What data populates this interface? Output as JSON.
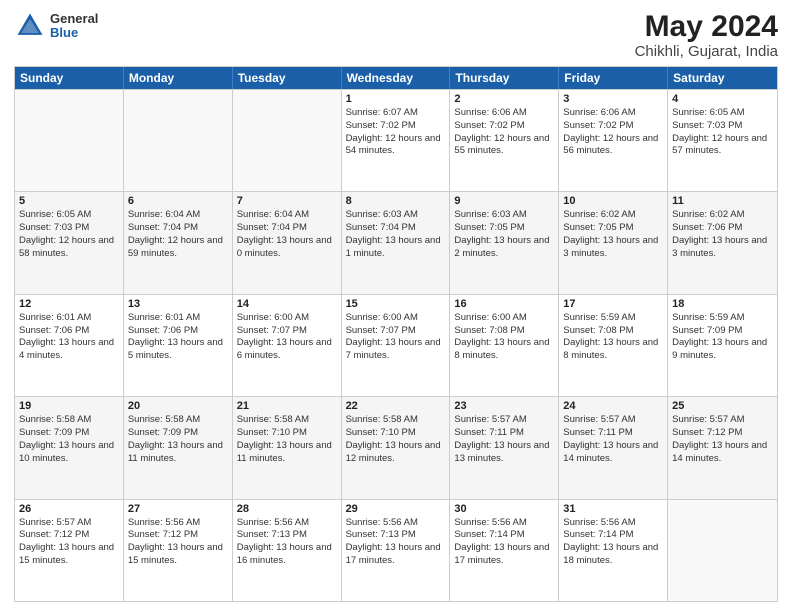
{
  "header": {
    "logo": {
      "general": "General",
      "blue": "Blue"
    },
    "title": "May 2024",
    "location": "Chikhli, Gujarat, India"
  },
  "calendar": {
    "days_of_week": [
      "Sunday",
      "Monday",
      "Tuesday",
      "Wednesday",
      "Thursday",
      "Friday",
      "Saturday"
    ],
    "weeks": [
      [
        {
          "day": "",
          "empty": true
        },
        {
          "day": "",
          "empty": true
        },
        {
          "day": "",
          "empty": true
        },
        {
          "day": "1",
          "sunrise": "6:07 AM",
          "sunset": "7:02 PM",
          "daylight": "12 hours and 54 minutes."
        },
        {
          "day": "2",
          "sunrise": "6:06 AM",
          "sunset": "7:02 PM",
          "daylight": "12 hours and 55 minutes."
        },
        {
          "day": "3",
          "sunrise": "6:06 AM",
          "sunset": "7:02 PM",
          "daylight": "12 hours and 56 minutes."
        },
        {
          "day": "4",
          "sunrise": "6:05 AM",
          "sunset": "7:03 PM",
          "daylight": "12 hours and 57 minutes."
        }
      ],
      [
        {
          "day": "5",
          "sunrise": "6:05 AM",
          "sunset": "7:03 PM",
          "daylight": "12 hours and 58 minutes."
        },
        {
          "day": "6",
          "sunrise": "6:04 AM",
          "sunset": "7:04 PM",
          "daylight": "12 hours and 59 minutes."
        },
        {
          "day": "7",
          "sunrise": "6:04 AM",
          "sunset": "7:04 PM",
          "daylight": "13 hours and 0 minutes."
        },
        {
          "day": "8",
          "sunrise": "6:03 AM",
          "sunset": "7:04 PM",
          "daylight": "13 hours and 1 minute."
        },
        {
          "day": "9",
          "sunrise": "6:03 AM",
          "sunset": "7:05 PM",
          "daylight": "13 hours and 2 minutes."
        },
        {
          "day": "10",
          "sunrise": "6:02 AM",
          "sunset": "7:05 PM",
          "daylight": "13 hours and 3 minutes."
        },
        {
          "day": "11",
          "sunrise": "6:02 AM",
          "sunset": "7:06 PM",
          "daylight": "13 hours and 3 minutes."
        }
      ],
      [
        {
          "day": "12",
          "sunrise": "6:01 AM",
          "sunset": "7:06 PM",
          "daylight": "13 hours and 4 minutes."
        },
        {
          "day": "13",
          "sunrise": "6:01 AM",
          "sunset": "7:06 PM",
          "daylight": "13 hours and 5 minutes."
        },
        {
          "day": "14",
          "sunrise": "6:00 AM",
          "sunset": "7:07 PM",
          "daylight": "13 hours and 6 minutes."
        },
        {
          "day": "15",
          "sunrise": "6:00 AM",
          "sunset": "7:07 PM",
          "daylight": "13 hours and 7 minutes."
        },
        {
          "day": "16",
          "sunrise": "6:00 AM",
          "sunset": "7:08 PM",
          "daylight": "13 hours and 8 minutes."
        },
        {
          "day": "17",
          "sunrise": "5:59 AM",
          "sunset": "7:08 PM",
          "daylight": "13 hours and 8 minutes."
        },
        {
          "day": "18",
          "sunrise": "5:59 AM",
          "sunset": "7:09 PM",
          "daylight": "13 hours and 9 minutes."
        }
      ],
      [
        {
          "day": "19",
          "sunrise": "5:58 AM",
          "sunset": "7:09 PM",
          "daylight": "13 hours and 10 minutes."
        },
        {
          "day": "20",
          "sunrise": "5:58 AM",
          "sunset": "7:09 PM",
          "daylight": "13 hours and 11 minutes."
        },
        {
          "day": "21",
          "sunrise": "5:58 AM",
          "sunset": "7:10 PM",
          "daylight": "13 hours and 11 minutes."
        },
        {
          "day": "22",
          "sunrise": "5:58 AM",
          "sunset": "7:10 PM",
          "daylight": "13 hours and 12 minutes."
        },
        {
          "day": "23",
          "sunrise": "5:57 AM",
          "sunset": "7:11 PM",
          "daylight": "13 hours and 13 minutes."
        },
        {
          "day": "24",
          "sunrise": "5:57 AM",
          "sunset": "7:11 PM",
          "daylight": "13 hours and 14 minutes."
        },
        {
          "day": "25",
          "sunrise": "5:57 AM",
          "sunset": "7:12 PM",
          "daylight": "13 hours and 14 minutes."
        }
      ],
      [
        {
          "day": "26",
          "sunrise": "5:57 AM",
          "sunset": "7:12 PM",
          "daylight": "13 hours and 15 minutes."
        },
        {
          "day": "27",
          "sunrise": "5:56 AM",
          "sunset": "7:12 PM",
          "daylight": "13 hours and 15 minutes."
        },
        {
          "day": "28",
          "sunrise": "5:56 AM",
          "sunset": "7:13 PM",
          "daylight": "13 hours and 16 minutes."
        },
        {
          "day": "29",
          "sunrise": "5:56 AM",
          "sunset": "7:13 PM",
          "daylight": "13 hours and 17 minutes."
        },
        {
          "day": "30",
          "sunrise": "5:56 AM",
          "sunset": "7:14 PM",
          "daylight": "13 hours and 17 minutes."
        },
        {
          "day": "31",
          "sunrise": "5:56 AM",
          "sunset": "7:14 PM",
          "daylight": "13 hours and 18 minutes."
        },
        {
          "day": "",
          "empty": true
        }
      ]
    ]
  }
}
